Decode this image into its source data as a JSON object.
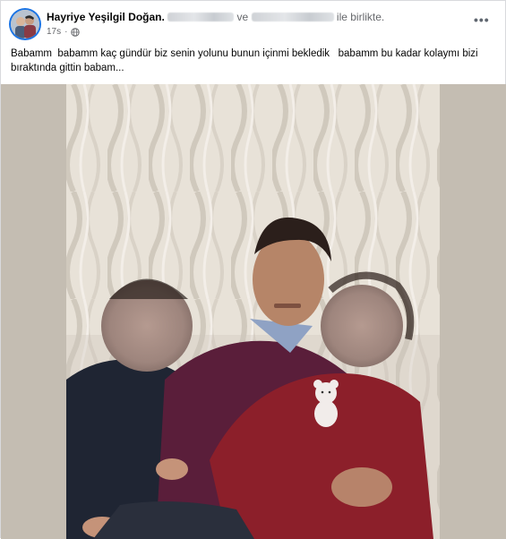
{
  "post": {
    "author_name": "Hayriye Yeşilgil Doğan.",
    "tag_connector": "ve",
    "tag_suffix": "ile birlikte.",
    "timestamp": "17s",
    "privacy_icon": "globe-icon",
    "more_icon": "more-options-icon",
    "caption": "Babamm  babamm kaç gündür biz senin yolunu bunun içinmi bekledik   babamm bu kadar kolaymı bizi bıraktında gittin babam...",
    "photo": {
      "description_icon": "photo"
    }
  },
  "colors": {
    "avatar_ring": "#1b74e4",
    "meta_text": "#65676b",
    "photo_backdrop": "#c4bdb2"
  }
}
